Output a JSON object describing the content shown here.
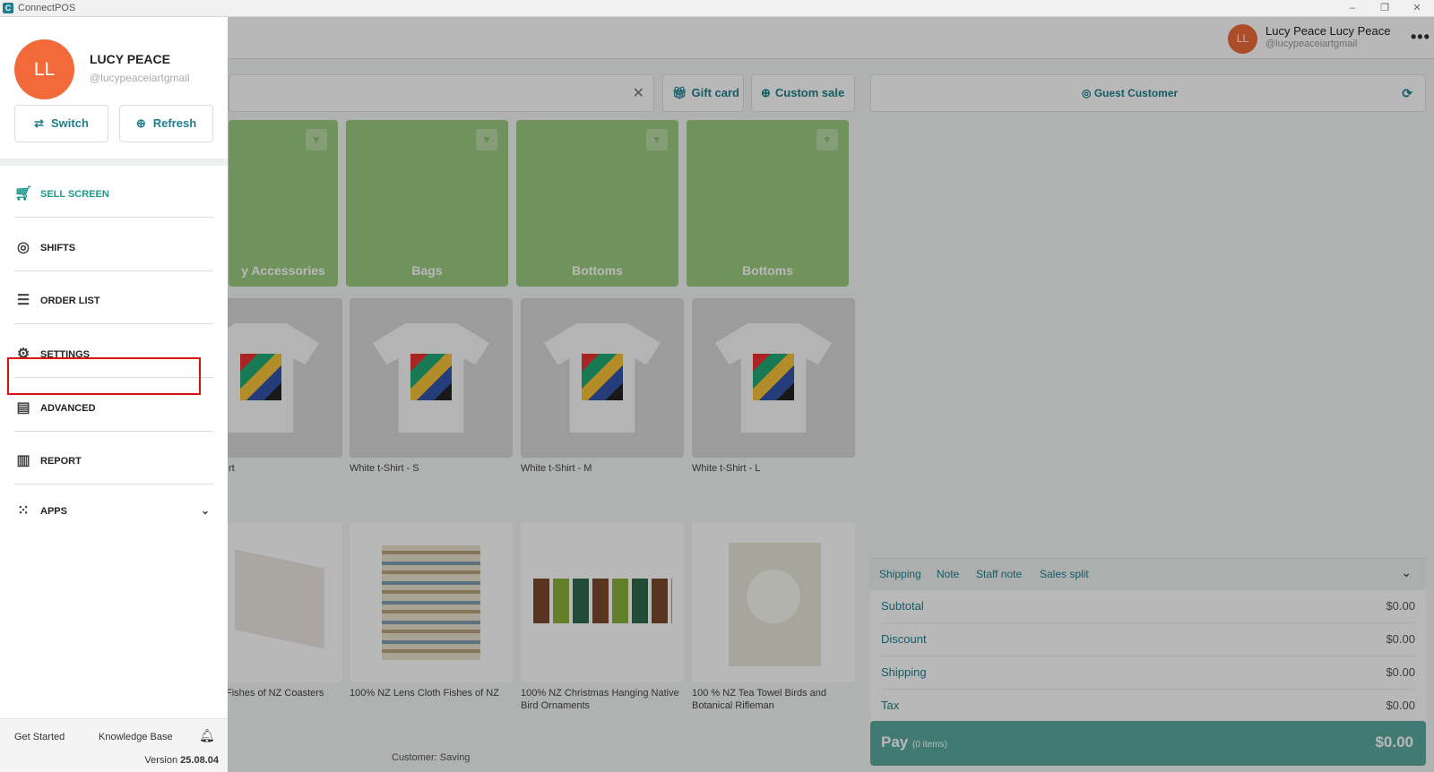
{
  "window": {
    "title": "ConnectPOS",
    "icon": "C",
    "minimize": "–",
    "restore": "❐",
    "close": "✕"
  },
  "topbar": {
    "user_initials": "LL",
    "user_name": "Lucy Peace Lucy Peace",
    "user_handle": "@lucypeaceiartgmail",
    "more": "•••"
  },
  "toolbar": {
    "gift_card": "Gift card",
    "custom_sale": "Custom sale",
    "guest_customer": "Guest Customer"
  },
  "categories": [
    "y Accessories",
    "Bags",
    "Bottoms",
    "Bottoms"
  ],
  "products_row1": [
    "rt",
    "White t-Shirt - S",
    "White t-Shirt - M",
    "White t-Shirt - L"
  ],
  "products_row2": [
    "Fishes of NZ Coasters",
    "100% NZ Lens Cloth Fishes of NZ",
    "100% NZ Christmas Hanging Native Bird Ornaments",
    "100 % NZ Tea Towel Birds and Botanical Rifleman"
  ],
  "cart": {
    "tabs": [
      "Shipping",
      "Note",
      "Staff note",
      "Sales split"
    ],
    "totals": [
      {
        "label": "Subtotal",
        "value": "$0.00"
      },
      {
        "label": "Discount",
        "value": "$0.00"
      },
      {
        "label": "Shipping",
        "value": "$0.00"
      },
      {
        "label": "Tax",
        "value": "$0.00"
      }
    ],
    "pay_label": "Pay",
    "pay_items": "(0 items)",
    "pay_value": "$0.00"
  },
  "customer_saving": "Customer: Saving",
  "drawer": {
    "initials": "LL",
    "name": "LUCY PEACE",
    "handle": "@lucypeaceiartgmail",
    "switch": "Switch",
    "refresh": "Refresh",
    "menu": [
      "SELL SCREEN",
      "SHIFTS",
      "ORDER LIST",
      "SETTINGS",
      "ADVANCED",
      "REPORT",
      "APPS"
    ],
    "get_started": "Get Started",
    "knowledge_base": "Knowledge Base",
    "version_label": "Version",
    "version": "25.08.04"
  },
  "colors": {
    "accent": "#1e7e8c",
    "category": "#9ccc82",
    "pay": "#5aa99e",
    "avatar": "#f26a3a",
    "highlight": "#e01010"
  }
}
